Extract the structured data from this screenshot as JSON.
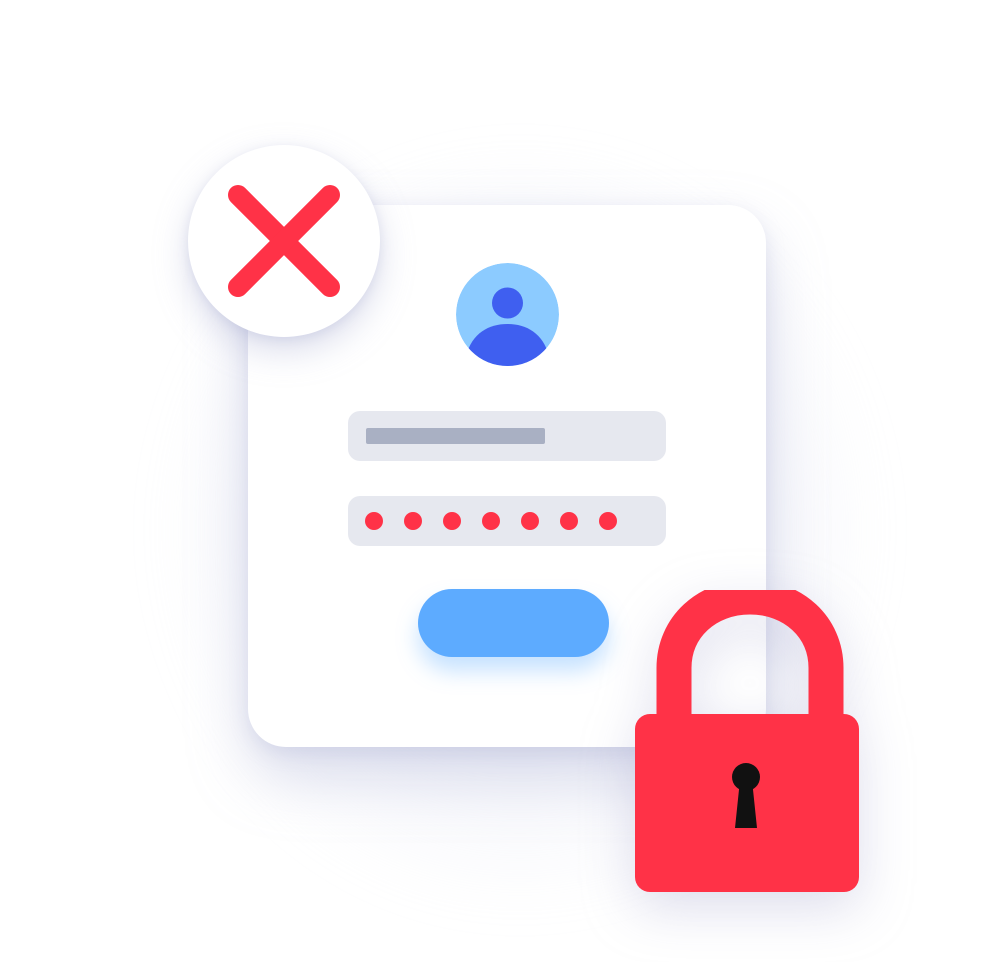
{
  "colors": {
    "background": "#ffffff",
    "card": "#ffffff",
    "field_background": "#e6e8ef",
    "username_placeholder_bar": "#a9b0c3",
    "password_dot": "#ff3247",
    "login_button": "#5dabff",
    "avatar_background": "#8ccbff",
    "avatar_figure": "#3f5ff0",
    "error_x": "#ff3247",
    "padlock_body": "#ff3247",
    "keyhole": "#111111"
  },
  "icons": {
    "avatar": "user-avatar-icon",
    "error": "close-x-icon",
    "padlock": "padlock-icon",
    "keyhole": "keyhole-icon"
  },
  "login_form": {
    "password_masked_char_count": 7
  }
}
